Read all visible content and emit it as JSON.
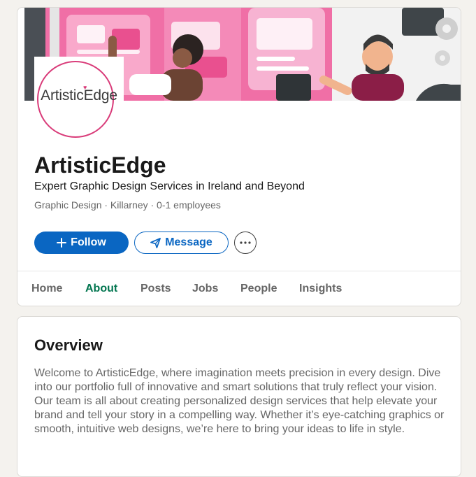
{
  "company": {
    "logo_text": "ArtisticEdge",
    "name": "ArtisticEdge",
    "tagline": "Expert Graphic Design Services in Ireland and Beyond",
    "meta": "Graphic Design · Killarney · 0-1 employees"
  },
  "actions": {
    "follow_label": "Follow",
    "message_label": "Message",
    "more_icon": "ellipsis-icon"
  },
  "tabs": [
    {
      "label": "Home"
    },
    {
      "label": "About",
      "active": true
    },
    {
      "label": "Posts"
    },
    {
      "label": "Jobs"
    },
    {
      "label": "People"
    },
    {
      "label": "Insights"
    }
  ],
  "overview": {
    "title": "Overview",
    "body": "Welcome to ArtisticEdge, where imagination meets precision in every design. Dive into our portfolio full of innovative and smart solutions that truly reflect your vision. Our team is all about creating personalized design services that help elevate your brand and tell your story in a compelling way. Whether it’s eye-catching graphics or smooth, intuitive web designs, we’re here to bring your ideas to life in style."
  },
  "colors": {
    "primary": "#0a66c2",
    "active_tab": "#01754f",
    "brand_pink": "#d93b79"
  }
}
